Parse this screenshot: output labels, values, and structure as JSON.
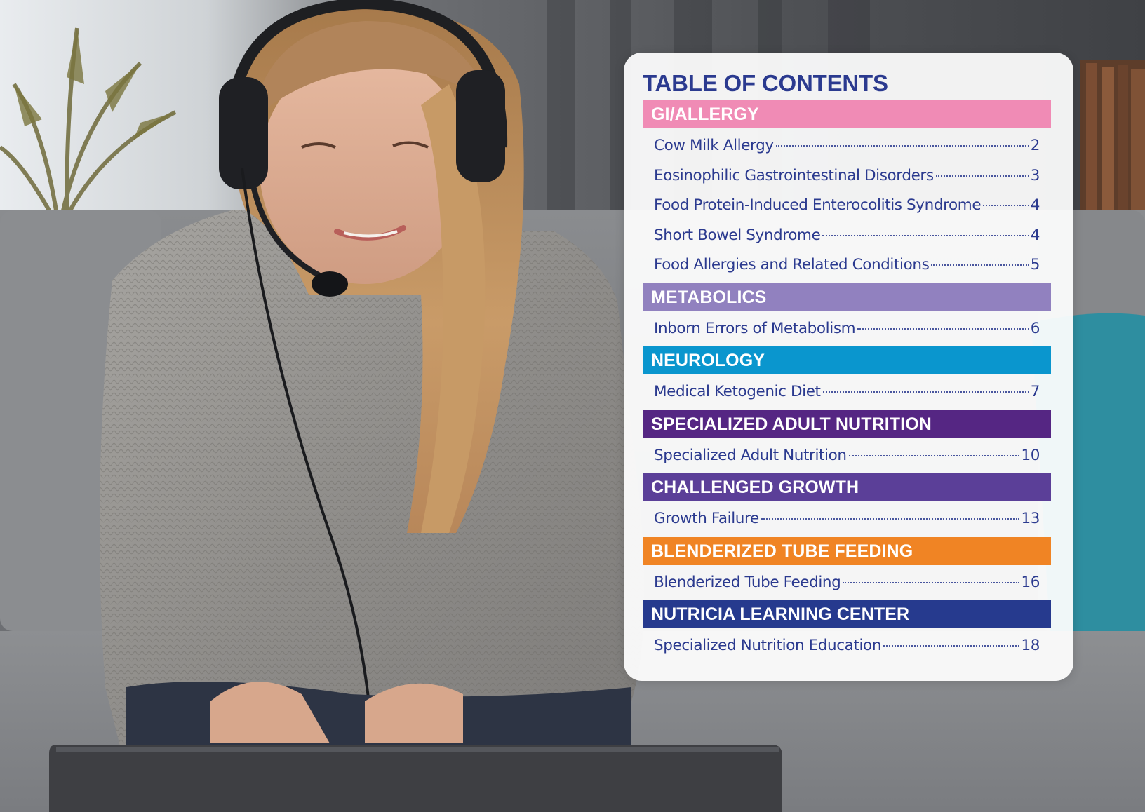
{
  "toc": {
    "title": "TABLE OF CONTENTS",
    "sections": [
      {
        "name": "GI/ALLERGY",
        "color": "#f08bb5",
        "entries": [
          {
            "label": "Cow Milk Allergy",
            "page": "2"
          },
          {
            "label": "Eosinophilic Gastrointestinal Disorders",
            "page": "3"
          },
          {
            "label": "Food Protein-Induced Enterocolitis Syndrome",
            "page": "4"
          },
          {
            "label": "Short Bowel Syndrome",
            "page": "4"
          },
          {
            "label": "Food Allergies and Related Conditions",
            "page": "5"
          }
        ]
      },
      {
        "name": "METABOLICS",
        "color": "#9181bf",
        "entries": [
          {
            "label": "Inborn Errors of Metabolism",
            "page": "6"
          }
        ]
      },
      {
        "name": "NEUROLOGY",
        "color": "#0a96ce",
        "entries": [
          {
            "label": "Medical Ketogenic Diet",
            "page": "7"
          }
        ]
      },
      {
        "name": "SPECIALIZED ADULT NUTRITION",
        "color": "#552683",
        "entries": [
          {
            "label": "Specialized Adult Nutrition",
            "page": "10"
          }
        ]
      },
      {
        "name": "CHALLENGED GROWTH",
        "color": "#5b3f98",
        "entries": [
          {
            "label": "Growth Failure",
            "page": "13"
          }
        ]
      },
      {
        "name": "BLENDERIZED TUBE FEEDING",
        "color": "#f08424",
        "entries": [
          {
            "label": "Blenderized Tube Feeding",
            "page": "16"
          }
        ]
      },
      {
        "name": "NUTRICIA LEARNING CENTER",
        "color": "#263a8e",
        "entries": [
          {
            "label": "Specialized Nutrition Education",
            "page": "18"
          }
        ]
      }
    ]
  },
  "colors": {
    "text": "#2b3a8f"
  }
}
